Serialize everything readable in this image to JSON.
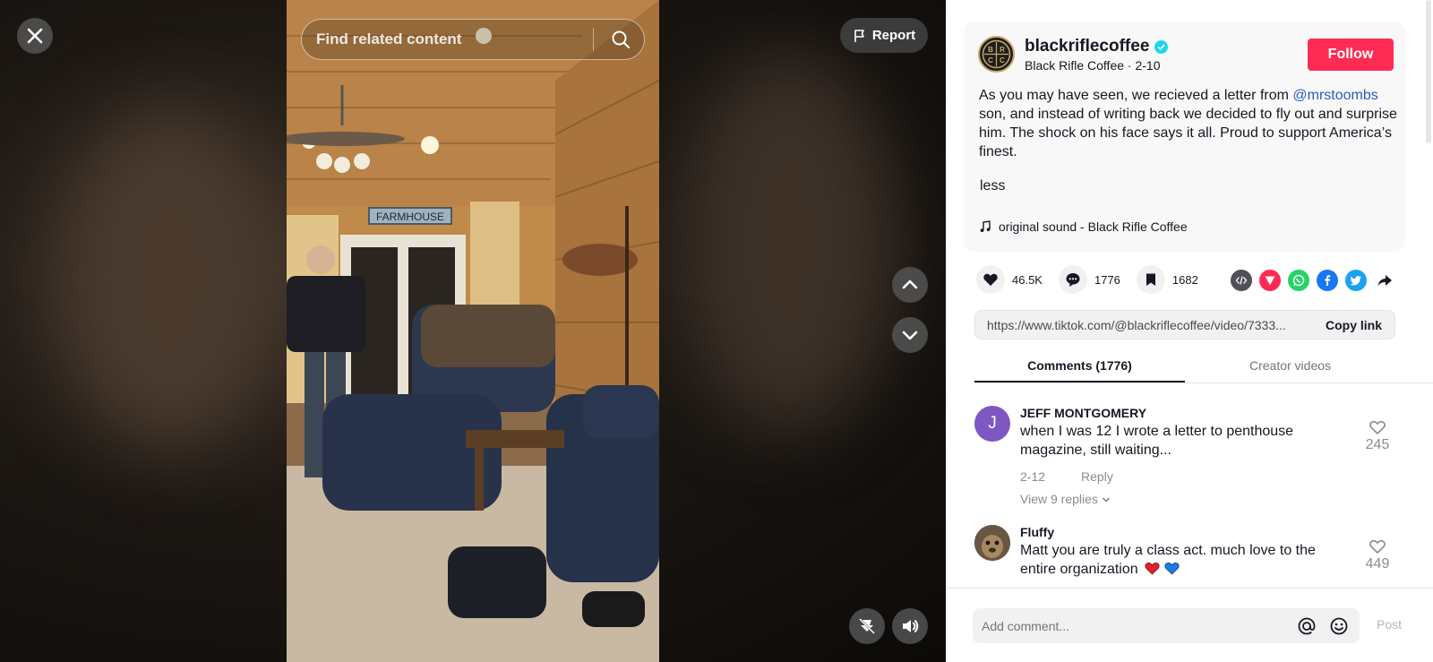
{
  "video": {
    "search_placeholder": "Find related content",
    "report_label": "Report",
    "sign_text": "FARMHOUSE"
  },
  "author": {
    "username": "blackriflecoffee",
    "display_name": "Black Rifle Coffee",
    "date": "2-10",
    "subline": "Black Rifle Coffee · 2-10",
    "logo_letters": [
      "B",
      "R",
      "C",
      "C"
    ],
    "follow_label": "Follow"
  },
  "description": {
    "before_mention": "As you may have seen, we recieved a letter from ",
    "mention": "@mrstoombs",
    "after_mention": " son, and instead of writing back we decided to fly out and surprise him. The shock on his face says it all. Proud to support America’s finest.",
    "less_label": "less",
    "sound": "original sound - Black Rifle Coffee"
  },
  "stats": {
    "likes": "46.5K",
    "comments": "1776",
    "saves": "1682"
  },
  "share": {
    "link": "https://www.tiktok.com/@blackriflecoffee/video/7333...",
    "copy_label": "Copy link"
  },
  "tabs": [
    {
      "label": "Comments (1776)",
      "active": true
    },
    {
      "label": "Creator videos",
      "active": false
    }
  ],
  "comments": [
    {
      "initial": "J",
      "avatar_color": "#7e57c2",
      "name": "JEFF MONTGOMERY",
      "text": "when I was 12 I wrote a letter to penthouse magazine, still waiting...",
      "date": "2-12",
      "reply_label": "Reply",
      "view_replies": "View 9 replies",
      "likes": "245"
    },
    {
      "name": "Fluffy",
      "text": "Matt you are truly a class act. much love to the entire organization",
      "likes": "449"
    }
  ],
  "composer": {
    "placeholder": "Add comment...",
    "post_label": "Post"
  },
  "colors": {
    "accent": "#fe2c55",
    "mention": "#2b5db9",
    "verified": "#20d5ec"
  }
}
